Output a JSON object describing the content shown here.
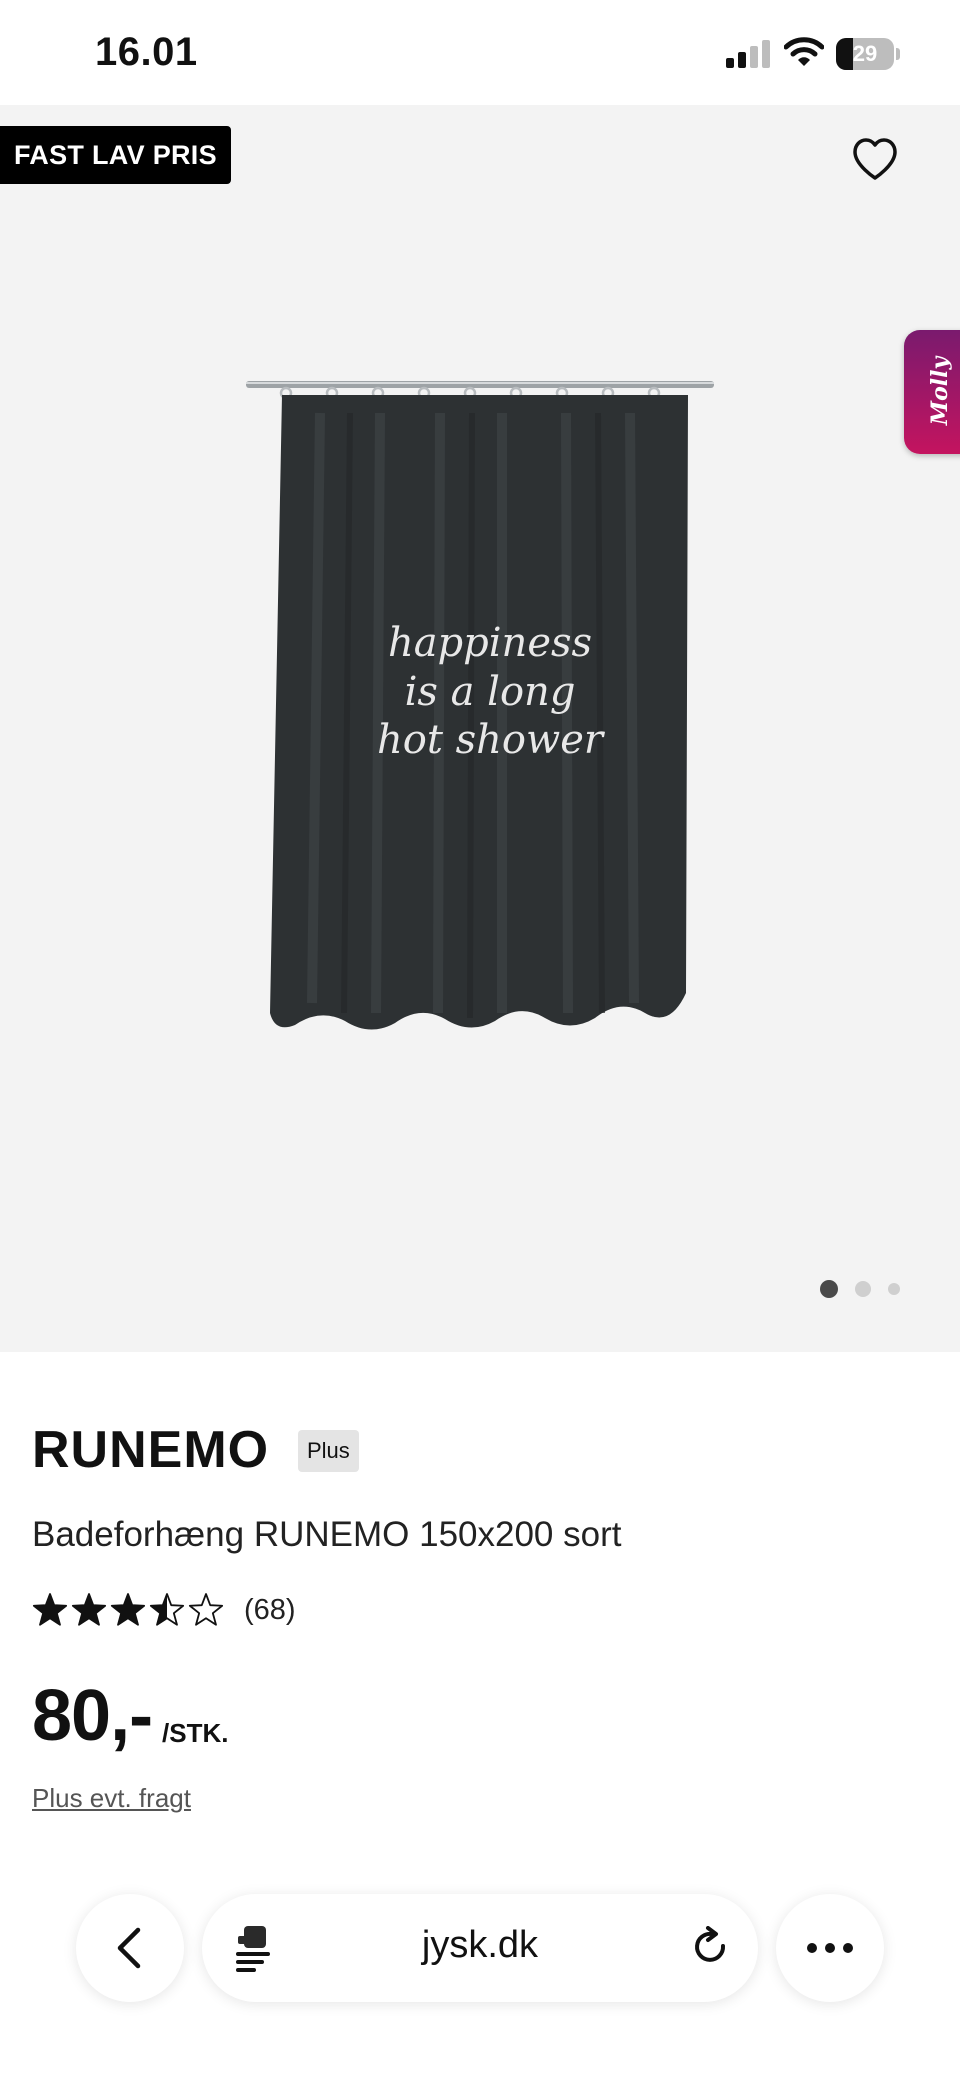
{
  "status_bar": {
    "time": "16.01",
    "battery_level": "29",
    "battery_fraction": 0.29,
    "signal_bars_filled": 2,
    "signal_bars_total": 4,
    "icons": [
      "signal-icon",
      "wifi-icon",
      "battery-icon"
    ]
  },
  "gallery": {
    "badge": "FAST LAV PRIS",
    "favorite_icon": "heart-outline-icon",
    "chat_tab_label": "Molly",
    "curtain_text": [
      "happiness",
      "is a long",
      "hot shower"
    ],
    "slide_count": 3,
    "active_slide": 1
  },
  "product": {
    "brand": "RUNEMO",
    "tag": "Plus",
    "name": "Badeforhæng RUNEMO 150x200 sort",
    "rating": 3.5,
    "rating_max": 5,
    "review_count": "(68)",
    "price": "80,-",
    "price_unit": "/STK.",
    "shipping_note": "Plus evt. fragt"
  },
  "browser": {
    "url": "jysk.dk",
    "back_icon": "chevron-left-icon",
    "reader_icon": "reader-mode-icon",
    "reload_icon": "reload-icon",
    "more_icon": "more-dots-icon"
  },
  "colors": {
    "badge_bg": "#000000",
    "gallery_bg": "#f3f3f3",
    "chat_tab_top": "#7a1a6e",
    "chat_tab_bottom": "#c4145f",
    "curtain": "#2d3133",
    "dot_active": "#4a4a4a",
    "dot_inactive": "#cfcfcf"
  }
}
